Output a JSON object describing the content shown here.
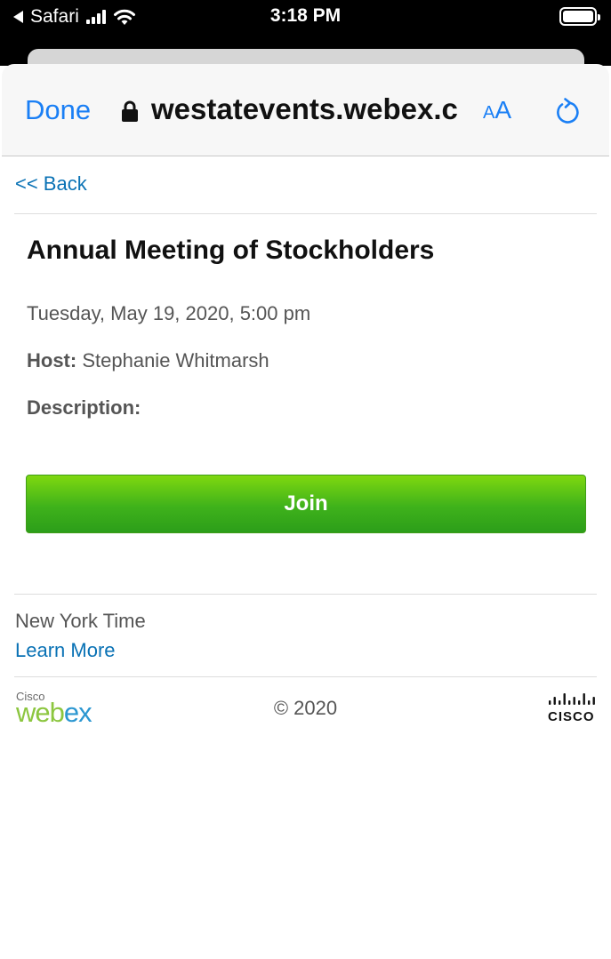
{
  "status_bar": {
    "back_app": "Safari",
    "time": "3:18 PM"
  },
  "browser": {
    "done_label": "Done",
    "url": "westatevents.webex.c",
    "text_size_small": "A",
    "text_size_large": "A",
    "accent_color": "#1a7ff5"
  },
  "page": {
    "back_link": "<< Back",
    "title": "Annual Meeting of Stockholders",
    "date_time": "Tuesday, May 19, 2020, 5:00 pm",
    "host_label": "Host:",
    "host_name": "Stephanie Whitmarsh",
    "description_label": "Description:",
    "join_label": "Join",
    "join_color": "#3fb21b"
  },
  "footer": {
    "timezone": "New York Time",
    "learn_more": "Learn More",
    "copyright": "© 2020",
    "webex_logo": {
      "small": "Cisco",
      "wordmark_green": "web",
      "wordmark_blue": "ex"
    },
    "cisco_logo": "CISCO",
    "link_color": "#0a72b5"
  }
}
